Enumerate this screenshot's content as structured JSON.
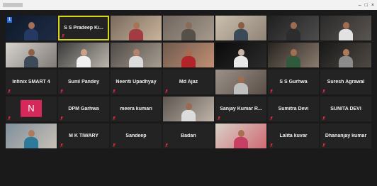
{
  "window": {
    "controls": [
      "–",
      "□",
      "×"
    ]
  },
  "colors": {
    "tile_bg": "#232323",
    "active_border": "#d6d61f",
    "avatar_bg": "#d6285a",
    "muted_mic": "#e0293a"
  },
  "participants": [
    {
      "label": "",
      "display_name": "",
      "type": "video",
      "badge": "1",
      "muted": false,
      "scene": [
        "#0f1a2a",
        "#1d2b44"
      ],
      "person": [
        "#a36f56",
        "#243a62"
      ]
    },
    {
      "label": "S S Pradeep Ki...",
      "display_name": "",
      "type": "name",
      "active": true,
      "muted": true
    },
    {
      "label": "",
      "display_name": "",
      "type": "video",
      "muted": false,
      "scene": [
        "#7a6a5e",
        "#c9b49c"
      ],
      "person": [
        "#a57558",
        "#a33b43"
      ]
    },
    {
      "label": "",
      "display_name": "",
      "type": "video",
      "muted": false,
      "scene": [
        "#6f665e",
        "#a79a8c"
      ],
      "person": [
        "#8a6a58",
        "#56504a"
      ]
    },
    {
      "label": "",
      "display_name": "",
      "type": "video",
      "muted": false,
      "scene": [
        "#cbbfae",
        "#8f8377"
      ],
      "person": [
        "#8c5e45",
        "#3b4a58"
      ]
    },
    {
      "label": "",
      "display_name": "",
      "type": "video",
      "muted": false,
      "scene": [
        "#1f1f1f",
        "#4d4d4d"
      ],
      "person": [
        "#9c6b50",
        "#2d2d2d"
      ]
    },
    {
      "label": "",
      "display_name": "",
      "type": "video",
      "muted": false,
      "scene": [
        "#2a2a2a",
        "#5a5550"
      ],
      "person": [
        "#a06c52",
        "#e2e2e2"
      ]
    },
    {
      "label": "",
      "display_name": "",
      "type": "video",
      "muted": false,
      "scene": [
        "#d7d3cf",
        "#7f7a76"
      ],
      "person": [
        "#8d5f44",
        "#3c4a5a"
      ]
    },
    {
      "label": "",
      "display_name": "",
      "type": "video",
      "muted": false,
      "scene": [
        "#3a3a3a",
        "#bdb6ad"
      ],
      "person": [
        "#c9a28a",
        "#f0f0f0"
      ]
    },
    {
      "label": "",
      "display_name": "",
      "type": "video",
      "muted": false,
      "scene": [
        "#4e4a46",
        "#a89d91"
      ],
      "person": [
        "#b6836a",
        "#dcdcdc"
      ]
    },
    {
      "label": "",
      "display_name": "",
      "type": "video",
      "muted": false,
      "scene": [
        "#6e5a4e",
        "#c28f73"
      ],
      "person": [
        "#a56a4f",
        "#b2242a"
      ]
    },
    {
      "label": "",
      "display_name": "",
      "type": "video",
      "muted": false,
      "scene": [
        "#0a0a0a",
        "#2b2b2b"
      ],
      "person": [
        "#c7b4a5",
        "#e8e8e8"
      ]
    },
    {
      "label": "",
      "display_name": "",
      "type": "video",
      "muted": false,
      "scene": [
        "#27231f",
        "#8a7b6e"
      ],
      "person": [
        "#a26f52",
        "#2f5a3b"
      ]
    },
    {
      "label": "",
      "display_name": "",
      "type": "video",
      "muted": false,
      "scene": [
        "#181818",
        "#504a44"
      ],
      "person": [
        "#b07a5d",
        "#8c8c8c"
      ]
    },
    {
      "label": "Infinix SMART 4",
      "display_name": "",
      "type": "name",
      "muted": true
    },
    {
      "label": "Sunil Pandey",
      "display_name": "",
      "type": "name",
      "muted": true
    },
    {
      "label": "Neeriti Upadhyay",
      "display_name": "",
      "type": "name",
      "muted": true
    },
    {
      "label": "Md Ajaz",
      "display_name": "",
      "type": "name",
      "muted": true
    },
    {
      "label": "",
      "display_name": "",
      "type": "video",
      "muted": false,
      "scene": [
        "#9b928a",
        "#5a4f47"
      ],
      "person": [
        "#a06c52",
        "#c0c0c0"
      ]
    },
    {
      "label": "S S Gurhwa",
      "display_name": "",
      "type": "name",
      "muted": true
    },
    {
      "label": "Suresh Agrawal",
      "display_name": "",
      "type": "name",
      "muted": true
    },
    {
      "label": "",
      "display_name": "",
      "type": "avatar",
      "avatar_letter": "N",
      "muted": true
    },
    {
      "label": "DPM Garhwa",
      "display_name": "",
      "type": "name",
      "muted": true
    },
    {
      "label": "meera kumari",
      "display_name": "",
      "type": "name",
      "muted": true
    },
    {
      "label": "",
      "display_name": "",
      "type": "video",
      "muted": false,
      "scene": [
        "#5c5550",
        "#bfb4a9"
      ],
      "person": [
        "#9a6a51",
        "#dcdcdc"
      ]
    },
    {
      "label": "Sanjay Kumar R...",
      "display_name": "",
      "type": "name",
      "muted": true
    },
    {
      "label": "Sumitra Devi",
      "display_name": "",
      "type": "name",
      "muted": true
    },
    {
      "label": "SUNITA DEVI",
      "display_name": "",
      "type": "name",
      "muted": true
    },
    {
      "label": "",
      "display_name": "",
      "type": "video",
      "muted": false,
      "scene": [
        "#7f8f9b",
        "#c8c0b6"
      ],
      "person": [
        "#b07a5d",
        "#2e7a9a"
      ]
    },
    {
      "label": "M K TIWARY",
      "display_name": "",
      "type": "name",
      "muted": true
    },
    {
      "label": "Sandeep",
      "display_name": "",
      "type": "name",
      "muted": true
    },
    {
      "label": "Badari",
      "display_name": "",
      "type": "name",
      "muted": true
    },
    {
      "label": "",
      "display_name": "",
      "type": "video",
      "muted": false,
      "scene": [
        "#d8d1c8",
        "#cf6a73"
      ],
      "person": [
        "#a8704f",
        "#c73f62"
      ]
    },
    {
      "label": "Lalita kuvar",
      "display_name": "",
      "type": "name",
      "muted": true
    },
    {
      "label": "Dhananjay kumar",
      "display_name": "",
      "type": "name",
      "muted": true
    }
  ]
}
